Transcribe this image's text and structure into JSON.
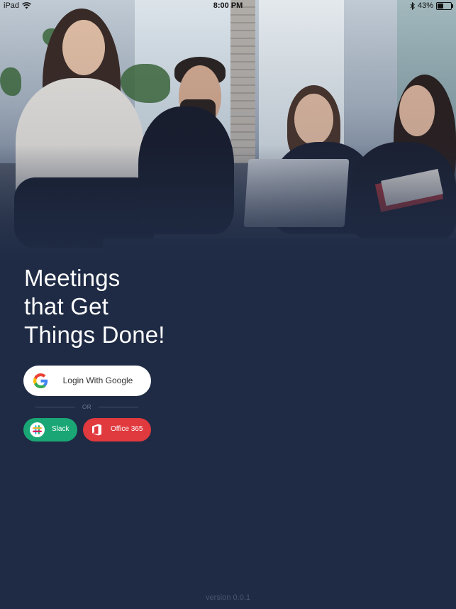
{
  "status_bar": {
    "device": "iPad",
    "time": "8:00 PM",
    "battery_percent": "43%",
    "battery_level": 0.43,
    "icons": [
      "wifi-icon",
      "bluetooth-icon",
      "battery-icon"
    ]
  },
  "hero": {
    "image": "team-meeting-photo"
  },
  "headline": {
    "line1": "Meetings",
    "line2": "that Get",
    "line3": "Things Done!"
  },
  "login": {
    "google_label": "Login With Google",
    "or_label": "OR",
    "slack_label": "Slack",
    "office_label": "Office 365"
  },
  "footer": {
    "version": "version 0.0.1"
  },
  "colors": {
    "background": "#1f2b45",
    "slack": "#1aa775",
    "office": "#e0393e",
    "google_button": "#ffffff"
  }
}
